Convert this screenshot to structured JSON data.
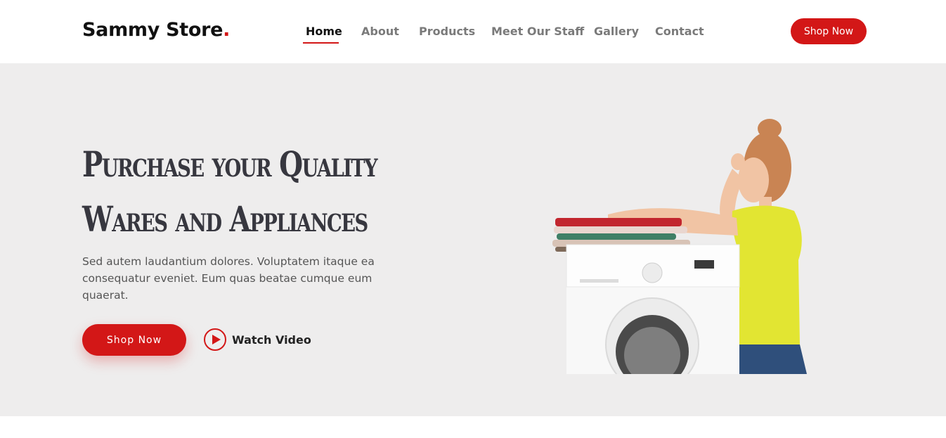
{
  "header": {
    "logo_text": "Sammy Store",
    "logo_dot": ".",
    "nav": [
      {
        "label": "Home",
        "active": true
      },
      {
        "label": "About",
        "active": false
      },
      {
        "label": "Products",
        "active": false
      },
      {
        "label": "Meet Our Staff",
        "active": false
      },
      {
        "label": "Gallery",
        "active": false
      },
      {
        "label": "Contact",
        "active": false
      }
    ],
    "cta_label": "Shop Now"
  },
  "hero": {
    "title_line1": "Purchase your Quality",
    "title_line2": "Wares and Appliances",
    "description": "Sed autem laudantium dolores. Voluptatem itaque ea consequatur eveniet. Eum quas beatae cumque eum quaerat.",
    "primary_button": "Shop Now",
    "video_button": "Watch Video",
    "image": "woman-leaning-on-washing-machine-with-folded-laundry"
  },
  "colors": {
    "accent": "#d31717",
    "hero_bg": "#eeeded",
    "title": "#37373f",
    "nav_inactive": "#7a7a7a"
  },
  "icons": {
    "play": "play-icon"
  }
}
